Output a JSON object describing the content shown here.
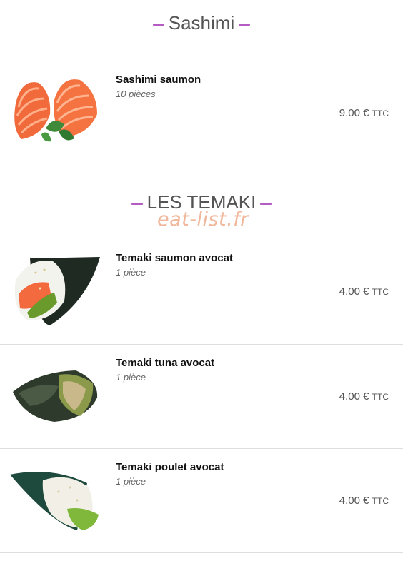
{
  "sections": [
    {
      "title": "Sashimi"
    },
    {
      "title": "LES TEMAKI"
    }
  ],
  "watermark": "eat-list.fr",
  "items": [
    {
      "name": "Sashimi saumon",
      "qty": "10 pièces",
      "price": "9.00 €",
      "tax": "TTC",
      "image": "salmon-sashimi-image"
    },
    {
      "name": "Temaki saumon avocat",
      "qty": "1 pièce",
      "price": "4.00 €",
      "tax": "TTC",
      "image": "salmon-avocado-temaki-image"
    },
    {
      "name": "Temaki tuna avocat",
      "qty": "1 pièce",
      "price": "4.00 €",
      "tax": "TTC",
      "image": "tuna-avocado-temaki-image"
    },
    {
      "name": "Temaki poulet avocat",
      "qty": "1 pièce",
      "price": "4.00 €",
      "tax": "TTC",
      "image": "chicken-avocado-temaki-image"
    }
  ],
  "colors": {
    "accent": "#b55bc4",
    "watermark": "#f0b79a",
    "title": "#555555",
    "divider": "#dedede"
  }
}
